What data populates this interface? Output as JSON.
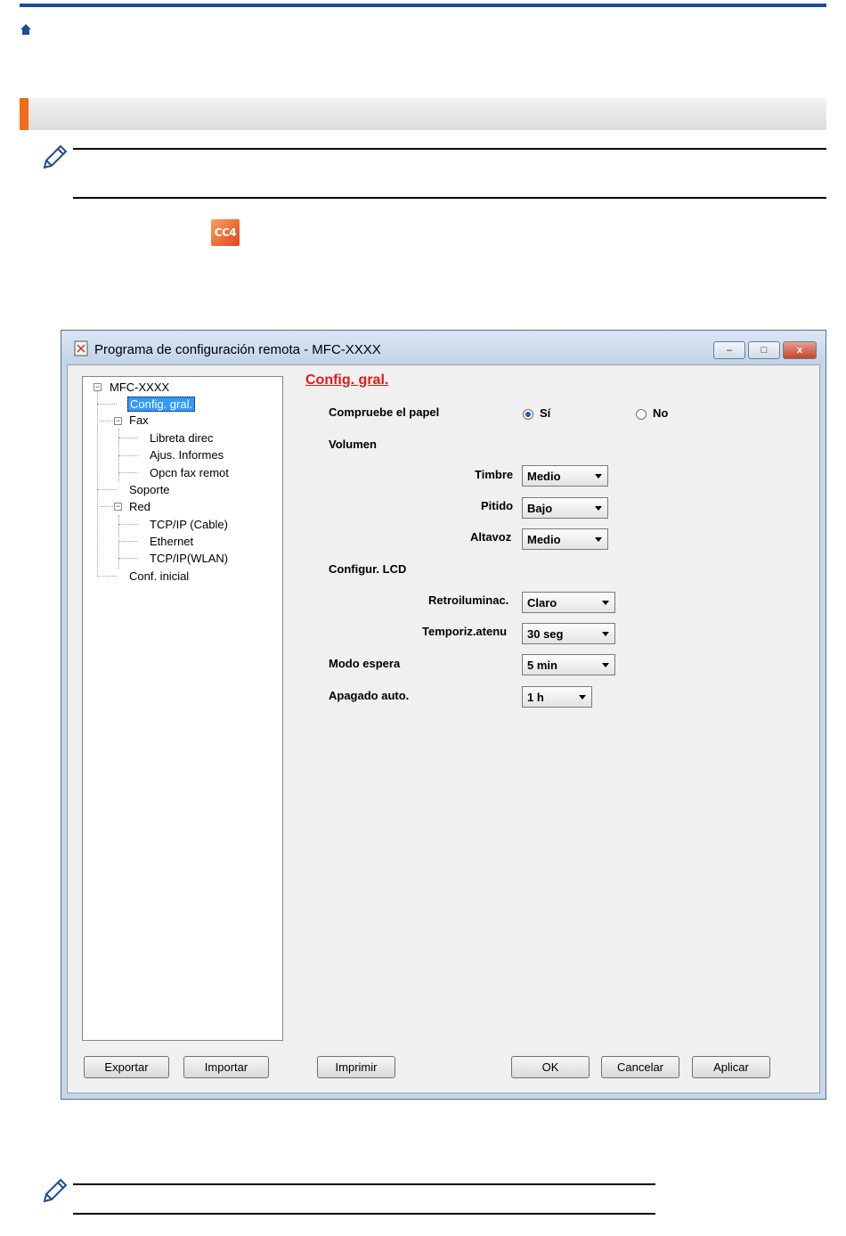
{
  "dialog": {
    "title": "Programa de configuración remota - MFC-XXXX",
    "tree": {
      "root": "MFC-XXXX",
      "items": [
        {
          "label": "Config. gral."
        },
        {
          "label": "Fax"
        },
        {
          "label": "Libreta direc"
        },
        {
          "label": "Ajus. Informes"
        },
        {
          "label": "Opcn fax remot"
        },
        {
          "label": "Soporte"
        },
        {
          "label": "Red"
        },
        {
          "label": "TCP/IP (Cable)"
        },
        {
          "label": "Ethernet"
        },
        {
          "label": "TCP/IP(WLAN)"
        },
        {
          "label": "Conf. inicial"
        }
      ]
    },
    "panel": {
      "heading": "Config. gral.",
      "check_paper": {
        "label": "Compruebe  el papel",
        "yes": "Sí",
        "no": "No",
        "selected": "Sí"
      },
      "volume": {
        "label": "Volumen",
        "ring": {
          "label": "Timbre",
          "value": "Medio"
        },
        "beep": {
          "label": "Pitido",
          "value": "Bajo"
        },
        "speaker": {
          "label": "Altavoz",
          "value": "Medio"
        }
      },
      "lcd": {
        "label": "Configur. LCD",
        "backlight": {
          "label": "Retroiluminac.",
          "value": "Claro"
        },
        "dim_timer": {
          "label": "Temporiz.atenu",
          "value": "30 seg"
        }
      },
      "sleep_mode": {
        "label": "Modo espera",
        "value": "5 min"
      },
      "auto_off": {
        "label": "Apagado auto.",
        "value": "1 h"
      }
    },
    "buttons": {
      "export": "Exportar",
      "import": "Importar",
      "print": "Imprimir",
      "ok": "OK",
      "cancel": "Cancelar",
      "apply": "Aplicar"
    },
    "caption_buttons": {
      "minimize": "–",
      "maximize": "□",
      "close": "x"
    }
  },
  "icons": {
    "home": "home-icon",
    "note": "pencil-note-icon",
    "cc4": "CC4"
  },
  "colors": {
    "accent": "#f26a1b",
    "top_rule": "#1e4a9c",
    "heading_red": "#e41b1b"
  }
}
